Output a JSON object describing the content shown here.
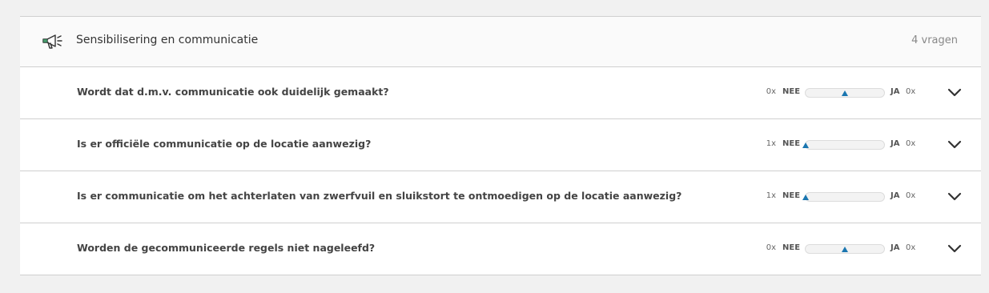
{
  "section": {
    "title": "Sensibilisering en communicatie",
    "count_label": "4 vragen",
    "icon": "megaphone-icon"
  },
  "poll_labels": {
    "no": "NEE",
    "yes": "JA"
  },
  "questions": [
    {
      "text": "Wordt dat d.m.v. communicatie ook duidelijk gemaakt?",
      "no_count": "0x",
      "yes_count": "0x",
      "marker_position_pct": 50
    },
    {
      "text": "Is er officiële communicatie op de locatie aanwezig?",
      "no_count": "1x",
      "yes_count": "0x",
      "marker_position_pct": 0
    },
    {
      "text": "Is er communicatie om het achterlaten van zwerfvuil en sluikstort te ontmoedigen op de locatie aanwezig?",
      "no_count": "1x",
      "yes_count": "0x",
      "marker_position_pct": 0
    },
    {
      "text": "Worden de gecommuniceerde regels niet nageleefd?",
      "no_count": "0x",
      "yes_count": "0x",
      "marker_position_pct": 50
    }
  ],
  "colors": {
    "marker": "#1a76b0",
    "background": "#f1f1f1"
  }
}
